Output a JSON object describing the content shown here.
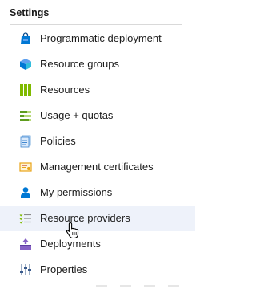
{
  "settings": {
    "title": "Settings",
    "items": [
      {
        "label": "Programmatic deployment",
        "icon": "shopping-bag-icon"
      },
      {
        "label": "Resource groups",
        "icon": "cube-icon"
      },
      {
        "label": "Resources",
        "icon": "grid-icon"
      },
      {
        "label": "Usage + quotas",
        "icon": "usage-bars-icon"
      },
      {
        "label": "Policies",
        "icon": "policy-document-icon"
      },
      {
        "label": "Management certificates",
        "icon": "certificate-icon"
      },
      {
        "label": "My permissions",
        "icon": "user-icon"
      },
      {
        "label": "Resource providers",
        "icon": "checklist-icon",
        "state": "hover"
      },
      {
        "label": "Deployments",
        "icon": "deployment-upload-icon"
      },
      {
        "label": "Properties",
        "icon": "properties-sliders-icon"
      }
    ]
  },
  "colors": {
    "hover_background": "#eef2fa",
    "icon_blue": "#0078d4",
    "icon_green": "#7fba00",
    "icon_purple": "#8661c5"
  }
}
